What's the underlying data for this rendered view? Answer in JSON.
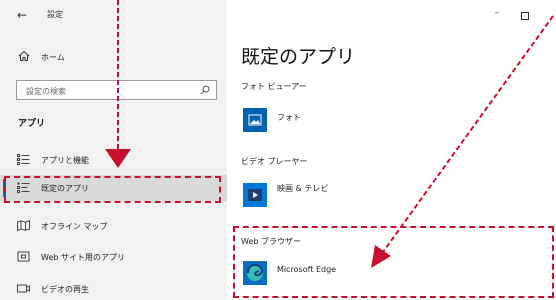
{
  "window": {
    "back_glyph": "←",
    "title": "設定",
    "minimize_glyph": "–"
  },
  "sidebar": {
    "home_label": "ホーム",
    "search_placeholder": "設定の検索",
    "section_title": "アプリ",
    "items": [
      {
        "label": "アプリと機能",
        "icon": "apps-features-icon"
      },
      {
        "label": "既定のアプリ",
        "icon": "default-apps-icon",
        "selected": true
      },
      {
        "label": "オフライン マップ",
        "icon": "offline-maps-icon"
      },
      {
        "label": "Web サイト用のアプリ",
        "icon": "apps-for-websites-icon"
      },
      {
        "label": "ビデオの再生",
        "icon": "video-playback-icon"
      }
    ]
  },
  "main": {
    "page_title": "既定のアプリ",
    "categories": [
      {
        "label": "フォト ビューアー",
        "app": "フォト",
        "icon": "photos-app-icon"
      },
      {
        "label": "ビデオ プレーヤー",
        "app": "映画 & テレビ",
        "icon": "movies-tv-app-icon"
      },
      {
        "label": "Web ブラウザー",
        "app": "Microsoft Edge",
        "icon": "edge-app-icon"
      }
    ]
  },
  "colors": {
    "annotation": "#c8102e",
    "accent": "#0067c0",
    "sidebar_bg": "#f2f2f2"
  }
}
